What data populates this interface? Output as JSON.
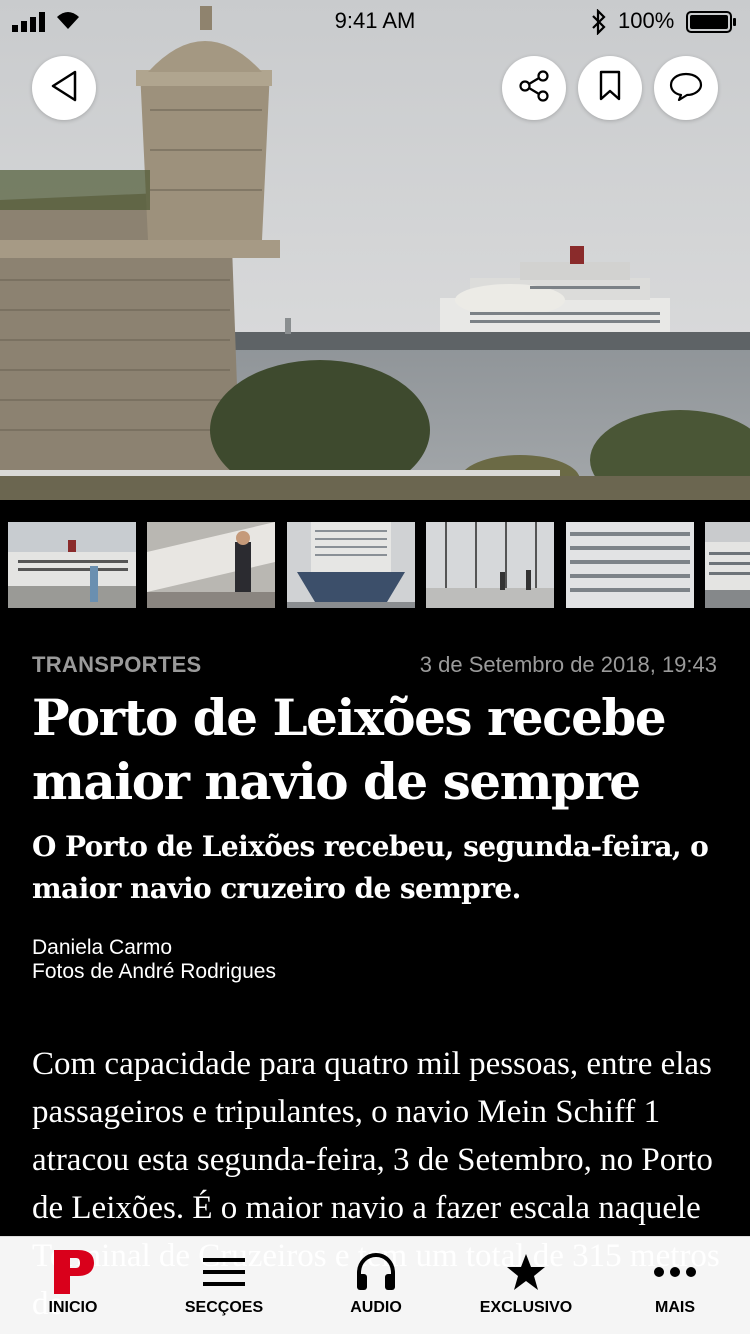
{
  "status_bar": {
    "time": "9:41 AM",
    "battery": "100%"
  },
  "hero": {
    "image": "fort-and-cruise-ship-photo"
  },
  "actions": {
    "back_icon": "back-triangle-icon",
    "share_icon": "share-icon",
    "bookmark_icon": "bookmark-icon",
    "comment_icon": "comment-icon"
  },
  "gallery": {
    "thumbnails": [
      "cruise-ship-deck",
      "porto-cruise-terminal",
      "ship-bow",
      "terminal-interior",
      "ship-cabins",
      "ship-side"
    ]
  },
  "article": {
    "category": "TRANSPORTES",
    "date": "3 de Setembro de 2018, 19:43",
    "headline": "Porto de Leixões recebe maior navio de sempre",
    "subtitle": "O Porto de Leixões recebeu, segunda-feira, o maior navio cruzeiro de sempre.",
    "author": "Daniela Carmo",
    "photographer": "Fotos de André Rodrigues",
    "body": "Com capacidade para quatro mil pessoas, entre elas passageiros e tripulantes, o navio Mein Schiff 1 atracou esta segunda-feira, 3 de Setembro, no Porto de Leixões. É o maior navio a fazer escala naquele Terminal de Cruzeiros e tem um total de 315 metros de"
  },
  "tab_bar": {
    "items": [
      {
        "label": "INICIO",
        "icon": "publico-p-logo-icon"
      },
      {
        "label": "SECÇOES",
        "icon": "menu-icon"
      },
      {
        "label": "AUDIO",
        "icon": "headphones-icon"
      },
      {
        "label": "EXCLUSIVO",
        "icon": "star-icon"
      },
      {
        "label": "MAIS",
        "icon": "more-dots-icon"
      }
    ]
  },
  "colors": {
    "background": "#000000",
    "meta_gray": "#9a9a9a",
    "brand_red": "#d9001b"
  }
}
